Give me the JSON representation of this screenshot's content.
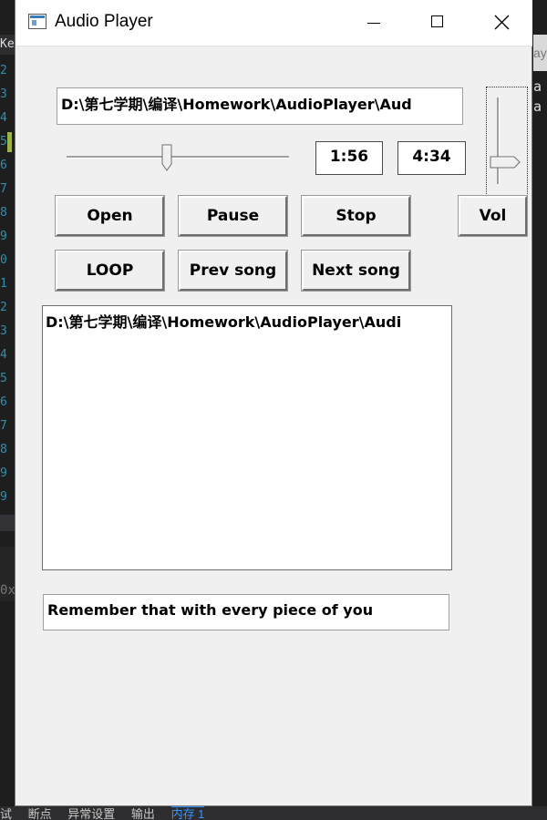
{
  "background": {
    "left_tab": "Ke",
    "line_numbers": [
      "2",
      "3",
      "4",
      "5",
      "6",
      "7",
      "8",
      "9",
      "0",
      "1",
      "2",
      "3",
      "4",
      "5",
      "6",
      "7",
      "8",
      "9",
      "9"
    ],
    "left_panel_text": "0x",
    "right_tab": "ay",
    "right_text": [
      "a",
      "a"
    ],
    "bottom_items": [
      "试",
      "断点",
      "异常设置",
      "输出",
      "内存 1"
    ]
  },
  "window": {
    "title": "Audio Player",
    "icons": {
      "app": "app-window-icon",
      "minimize": "minimize-icon",
      "maximize": "maximize-icon",
      "close": "close-icon"
    },
    "path_field": "D:\\第七学期\\编译\\Homework\\AudioPlayer\\Aud",
    "position_slider": {
      "value_fraction": 0.45
    },
    "current_time": "1:56",
    "total_time": "4:34",
    "volume_slider": {
      "value_fraction": 0.25
    },
    "buttons": {
      "open": "Open",
      "pause": "Pause",
      "stop": "Stop",
      "vol": "Vol",
      "loop": "LOOP",
      "prev": "Prev song",
      "next": "Next song"
    },
    "playlist": [
      "D:\\第七学期\\编译\\Homework\\AudioPlayer\\Audi"
    ],
    "lyric_field": "Remember that with every piece of you"
  }
}
